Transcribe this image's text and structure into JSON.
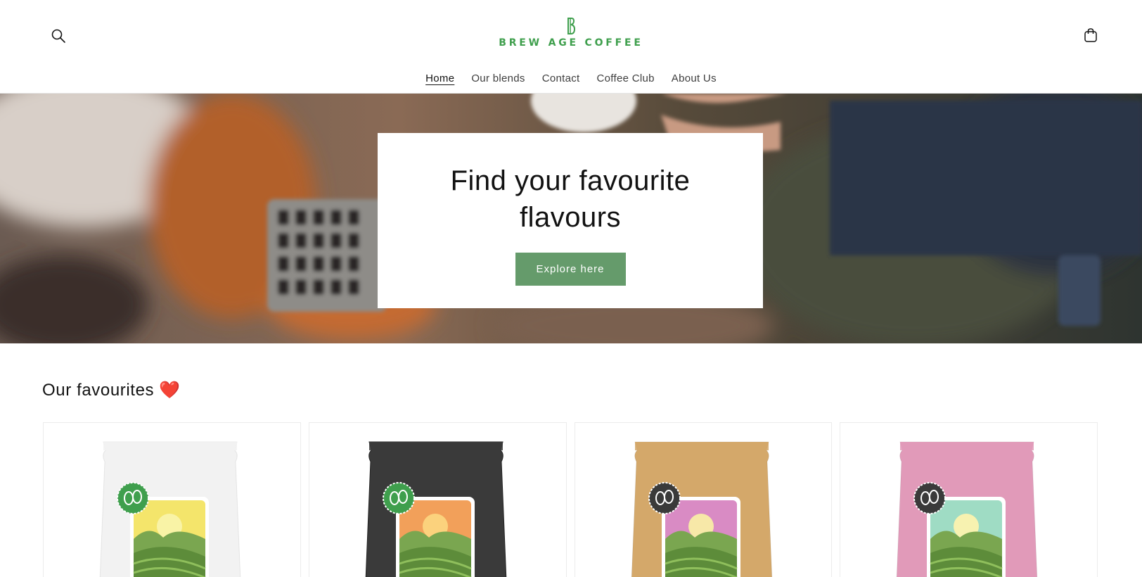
{
  "header": {
    "logo_text": "BREW AGE COFFEE",
    "logo_mark": "B",
    "brand_color": "#3f9f4d",
    "icons": {
      "search": "search-icon",
      "cart": "cart-icon"
    }
  },
  "nav": {
    "items": [
      {
        "label": "Home",
        "active": true
      },
      {
        "label": "Our blends",
        "active": false
      },
      {
        "label": "Contact",
        "active": false
      },
      {
        "label": "Coffee Club",
        "active": false
      },
      {
        "label": "About Us",
        "active": false
      }
    ]
  },
  "hero": {
    "title": "Find your favourite flavours",
    "button_label": "Explore here",
    "button_color": "#659b6b"
  },
  "favourites": {
    "title": "Our favourites",
    "emoji": "❤️",
    "products": [
      {
        "bag_color": "#f2f2f2",
        "badge_color": "#3f9f4d",
        "sky": "#f4e56b",
        "sun": "#f9f3a6"
      },
      {
        "bag_color": "#3a3a3a",
        "badge_color": "#3f9f4d",
        "sky": "#f2a05a",
        "sun": "#fbd27d"
      },
      {
        "bag_color": "#d4a86a",
        "badge_color": "#3a3a3a",
        "sky": "#d98bc4",
        "sun": "#f7e8a8"
      },
      {
        "bag_color": "#e19ab9",
        "badge_color": "#3a3a3a",
        "sky": "#9fdcc4",
        "sun": "#f7f2b0"
      }
    ]
  }
}
